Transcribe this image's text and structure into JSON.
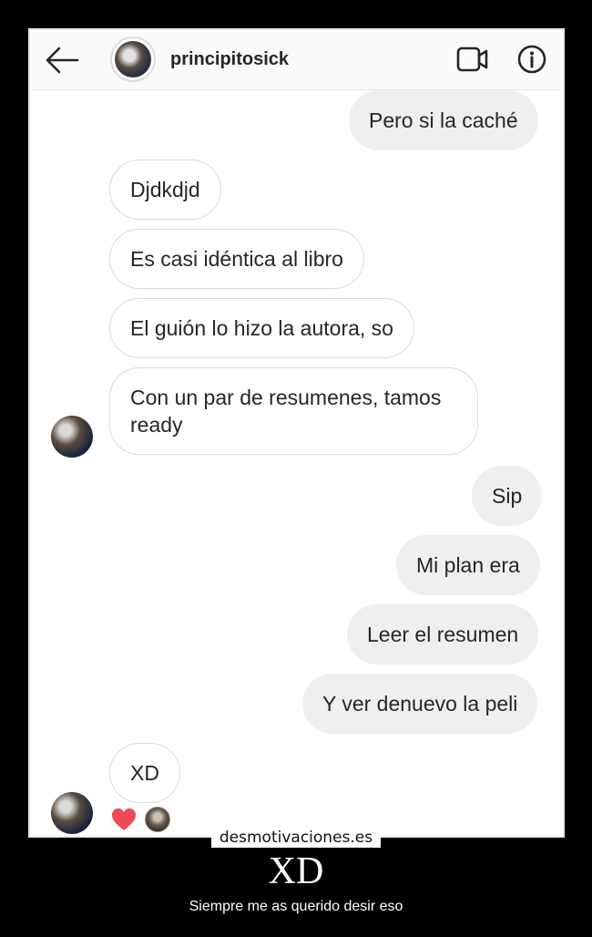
{
  "header": {
    "username": "principitosick",
    "back_icon": "arrow-left-icon",
    "video_icon": "video-camera-icon",
    "info_icon": "info-icon"
  },
  "messages": [
    {
      "side": "out",
      "text": "Pero si la caché"
    },
    {
      "side": "in",
      "text": "Djdkdjd"
    },
    {
      "side": "in",
      "text": "Es casi idéntica al libro"
    },
    {
      "side": "in",
      "text": "El guión lo hizo la autora, so"
    },
    {
      "side": "in",
      "lines": [
        "Con un par de resumenes, tamos",
        "ready"
      ]
    },
    {
      "side": "out",
      "text": "Sip"
    },
    {
      "side": "out",
      "text": "Mi plan era"
    },
    {
      "side": "out",
      "text": "Leer el resumen"
    },
    {
      "side": "out",
      "text": "Y ver denuevo la peli"
    },
    {
      "side": "in",
      "text": "XD"
    }
  ],
  "reaction": {
    "icon": "heart-icon",
    "color": "#ed4956"
  },
  "poster": {
    "watermark": "desmotivaciones.es",
    "title": "XD",
    "caption": "Siempre me as querido desir eso"
  }
}
